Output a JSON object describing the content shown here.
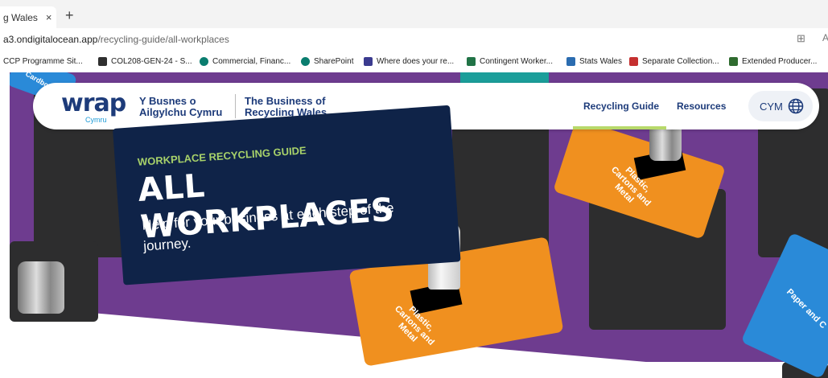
{
  "browser": {
    "tab_title": "g Wales",
    "tab_close": "×",
    "new_tab": "+",
    "url_domain": "a3.ondigitalocean.app",
    "url_path": "/recycling-guide/all-workplaces",
    "bookmarks": [
      {
        "label": "CCP Programme Sit...",
        "color": "#ffffff"
      },
      {
        "label": "COL208-GEN-24 - S...",
        "color": "#2f2f2f"
      },
      {
        "label": "Commercial, Financ...",
        "color": "#0a7d6f"
      },
      {
        "label": "SharePoint",
        "color": "#0a7d6f"
      },
      {
        "label": "Where does your re...",
        "color": "#3b3b8f"
      },
      {
        "label": "Contingent Worker...",
        "color": "#217346"
      },
      {
        "label": "Stats Wales",
        "color": "#2b6cb0"
      },
      {
        "label": "Separate Collection...",
        "color": "#c53030"
      },
      {
        "label": "Extended Producer...",
        "color": "#2f6b2f"
      }
    ]
  },
  "nav": {
    "logo": "wrap",
    "logo_sub": "Cymru",
    "brand_welsh_1": "Y Busnes o",
    "brand_welsh_2": "Ailgylchu Cymru",
    "brand_english_1": "The Business of",
    "brand_english_2": "Recycling Wales",
    "links": [
      "Recycling Guide",
      "Resources"
    ],
    "language": "CYM"
  },
  "hero": {
    "eyebrow": "WORKPLACE RECYCLING GUIDE",
    "title": "ALL WORKPLACES",
    "subtitle": "Help for your business at each step of the journey.",
    "bin_labels": [
      "Plastic, Cartons and Metal",
      "Plastic, Cartons and Metal",
      "Paper and C",
      "Cardboa"
    ]
  },
  "colors": {
    "navy": "#0f2348",
    "purple": "#6e3c8f",
    "orange": "#f0901f",
    "blue": "#2a8ad8",
    "green_accent": "#a8d26a"
  }
}
